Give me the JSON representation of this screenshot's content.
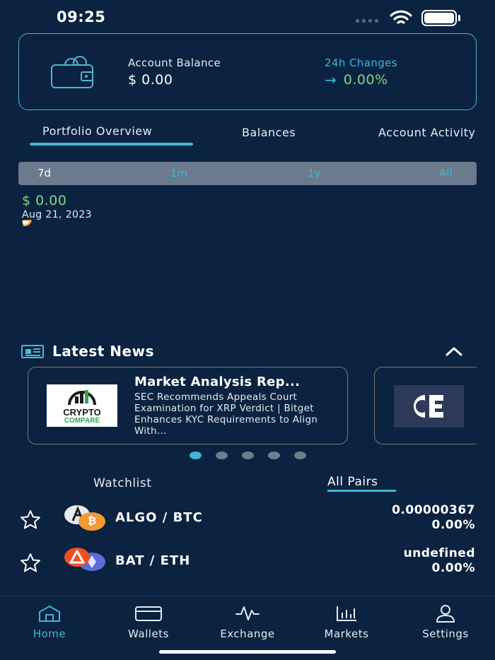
{
  "status_bar": {
    "time": "09:25"
  },
  "balance_card": {
    "balance_label": "Account Balance",
    "balance_value": "$ 0.00",
    "change_label": "24h Changes",
    "change_arrow": "→",
    "change_value": "0.00%"
  },
  "tabs": [
    {
      "label": "Portfolio Overview",
      "active": true
    },
    {
      "label": "Balances",
      "active": false
    },
    {
      "label": "Account Activity",
      "active": false
    }
  ],
  "range": {
    "options": [
      "7d",
      "1m",
      "1y",
      "All"
    ],
    "selected": "7d"
  },
  "chart": {
    "value": "$ 0.00",
    "date": "Aug 21, 2023"
  },
  "news": {
    "section_title": "Latest News",
    "cards": [
      {
        "logo_line1": "CRYPTO",
        "logo_line2": "COMPARE",
        "headline": "Market Analysis Rep...",
        "body": "SEC Recommends Appeals Court Examination for XRP Verdict | Bitget Enhances KYC Requirements to Align With..."
      },
      {
        "headline": "",
        "body": ""
      }
    ],
    "page_count": 5,
    "active_page": 0
  },
  "watchlist": {
    "tab_watchlist": "Watchlist",
    "tab_all_pairs": "All Pairs",
    "pairs": [
      {
        "name": "ALGO / BTC",
        "price": "0.00000367",
        "change": "0.00%"
      },
      {
        "name": "BAT / ETH",
        "price": "undefined",
        "change": "0.00%"
      }
    ]
  },
  "bottom_nav": [
    {
      "label": "Home",
      "icon": "home-icon",
      "active": true
    },
    {
      "label": "Wallets",
      "icon": "wallet-icon",
      "active": false
    },
    {
      "label": "Exchange",
      "icon": "pulse-icon",
      "active": false
    },
    {
      "label": "Markets",
      "icon": "bar-chart-icon",
      "active": false
    },
    {
      "label": "Settings",
      "icon": "user-icon",
      "active": false
    }
  ],
  "colors": {
    "background": "#0b2240",
    "accent": "#3fb8d8",
    "positive": "#7fd88a"
  }
}
